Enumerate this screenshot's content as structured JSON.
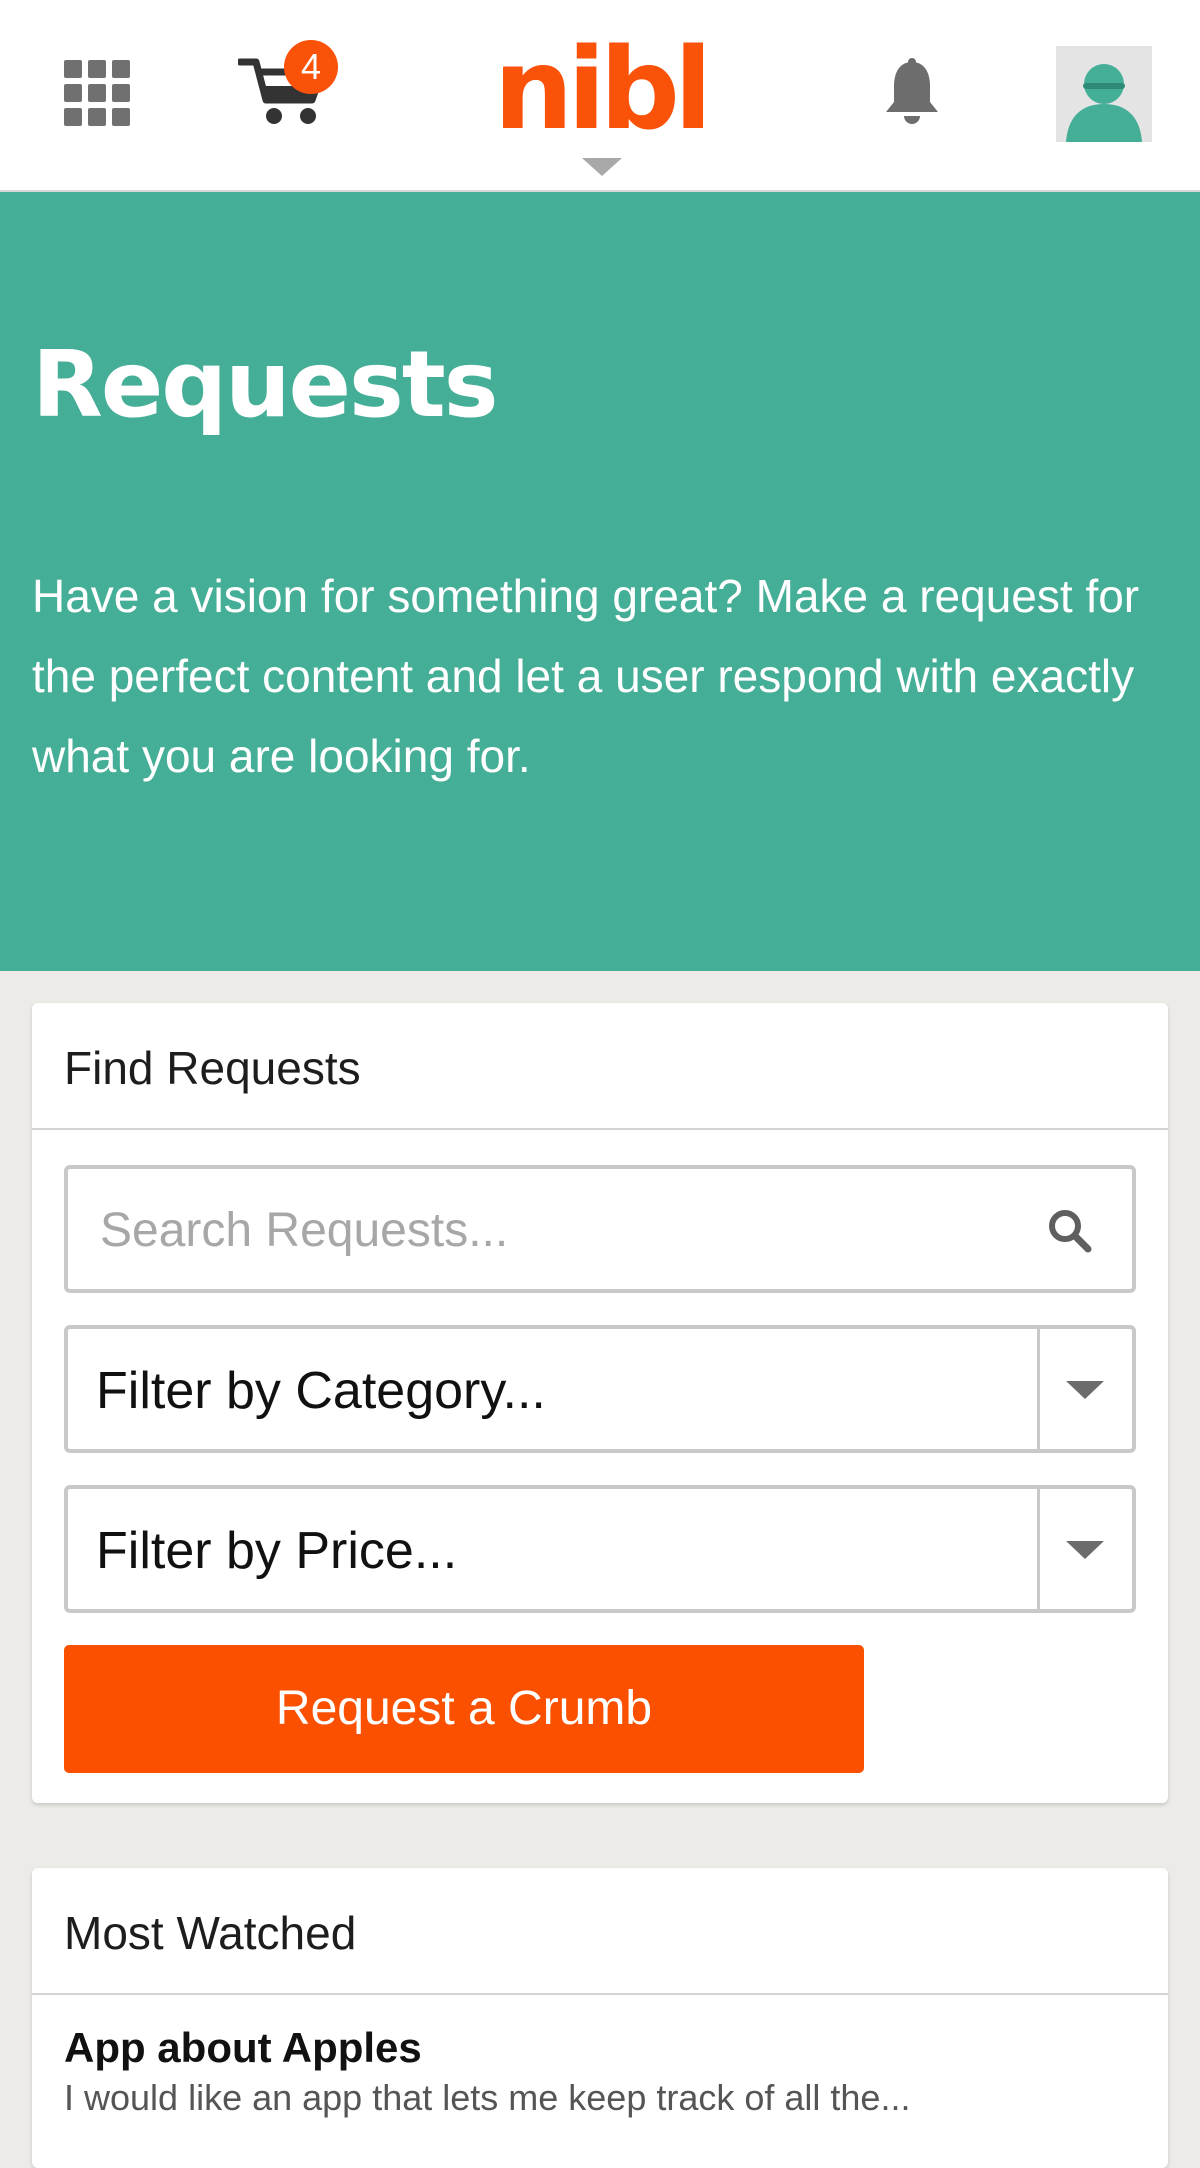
{
  "header": {
    "logo_text": "nibl",
    "cart_count": "4",
    "icons": {
      "menu": "apps-grid-icon",
      "cart": "shopping-cart-icon",
      "notifications": "bell-icon",
      "profile": "user-avatar-icon"
    }
  },
  "hero": {
    "title": "Requests",
    "description": "Have a vision for something great? Make a request for the perfect content and let a user respond with exactly what you are looking for."
  },
  "find_requests": {
    "title": "Find Requests",
    "search_placeholder": "Search Requests...",
    "category_filter": "Filter by Category...",
    "price_filter": "Filter by Price...",
    "request_button": "Request a Crumb"
  },
  "most_watched": {
    "title": "Most Watched",
    "items": [
      {
        "title": "App about Apples",
        "description": "I would like an app that lets me keep track of all the..."
      }
    ]
  },
  "colors": {
    "brand_orange": "#fa5209",
    "hero_teal": "#45ae96",
    "page_background": "#ecebe8"
  }
}
